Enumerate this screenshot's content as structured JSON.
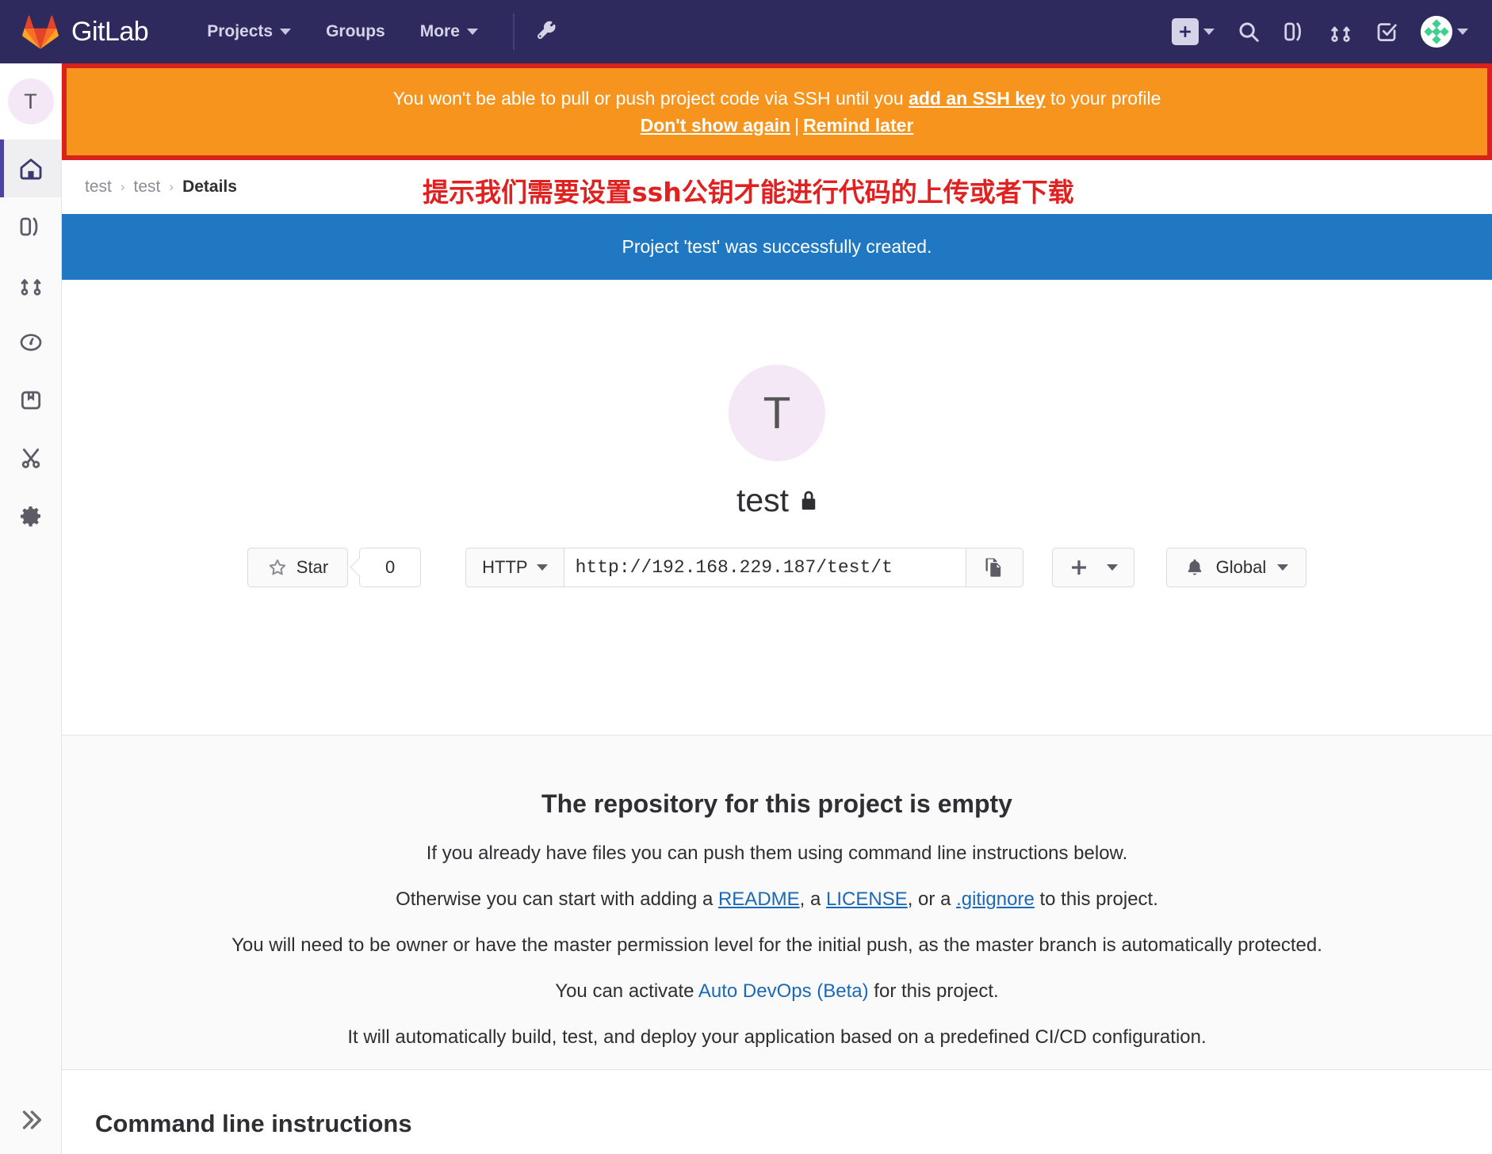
{
  "nav": {
    "brand": "GitLab",
    "links": [
      {
        "label": "Projects",
        "icon": "chevron-down-icon",
        "has_caret": true
      },
      {
        "label": "Groups",
        "has_caret": false
      },
      {
        "label": "More",
        "icon": "chevron-down-icon",
        "has_caret": true
      }
    ],
    "tool_icon": "wrench-icon",
    "right_icons": [
      {
        "name": "new-dropdown",
        "icon": "plus-icon",
        "has_caret": true
      },
      {
        "name": "search",
        "icon": "search-icon"
      },
      {
        "name": "issues",
        "icon": "issues-icon"
      },
      {
        "name": "merge-requests",
        "icon": "merge-request-icon"
      },
      {
        "name": "todos",
        "icon": "todo-check-icon"
      },
      {
        "name": "user-menu",
        "icon": "avatar-icon",
        "has_caret": true
      }
    ]
  },
  "sidebar": {
    "avatar_letter": "T",
    "items": [
      {
        "name": "project-overview",
        "icon": "home-icon",
        "active": true
      },
      {
        "name": "issues",
        "icon": "issues-icon",
        "active": false
      },
      {
        "name": "merge-requests",
        "icon": "merge-request-icon",
        "active": false
      },
      {
        "name": "ci-cd",
        "icon": "pipeline-icon",
        "active": false
      },
      {
        "name": "packages",
        "icon": "package-icon",
        "active": false
      },
      {
        "name": "snippets",
        "icon": "scissors-icon",
        "active": false
      },
      {
        "name": "settings",
        "icon": "gear-icon",
        "active": false
      }
    ],
    "collapse_icon": "chevron-double-right-icon"
  },
  "ssh_alert": {
    "text_before": "You won't be able to pull or push project code via SSH until you ",
    "link": "add an SSH key",
    "text_after": " to your profile",
    "dont_show": "Don't show again",
    "separator": "|",
    "remind_later": "Remind later",
    "background_color": "#f7941e",
    "annotation_border_color": "#d8221b"
  },
  "annotation": {
    "chinese_note": "提示我们需要设置ssh公钥才能进行代码的上传或者下载",
    "color": "#e02120"
  },
  "breadcrumb": {
    "items": [
      "test",
      "test"
    ],
    "current": "Details",
    "separator": "›"
  },
  "flash": {
    "message": "Project 'test' was successfully created.",
    "color": "#1f78c1"
  },
  "project": {
    "avatar_letter": "T",
    "name": "test",
    "visibility_icon": "lock-icon",
    "star_label": "Star",
    "star_count": "0",
    "star_icon": "star-icon",
    "clone_protocol": "HTTP",
    "clone_url": "http://192.168.229.187/test/t",
    "copy_icon": "copy-icon",
    "plus_icon": "plus-icon",
    "notification_icon": "bell-icon",
    "notification_level": "Global"
  },
  "empty_repo": {
    "title": "The repository for this project is empty",
    "line1": "If you already have files you can push them using command line instructions below.",
    "line2_a": "Otherwise you can start with adding a ",
    "link_readme": "README",
    "line2_b": ", a ",
    "link_license": "LICENSE",
    "line2_c": ", or a ",
    "link_gitignore": ".gitignore",
    "line2_d": " to this project.",
    "line3": "You will need to be owner or have the master permission level for the initial push, as the master branch is automatically protected.",
    "line4_a": "You can activate ",
    "link_autodevops": "Auto DevOps (Beta)",
    "line4_b": " for this project.",
    "line5": "It will automatically build, test, and deploy your application based on a predefined CI/CD configuration."
  },
  "cli": {
    "title": "Command line instructions"
  }
}
